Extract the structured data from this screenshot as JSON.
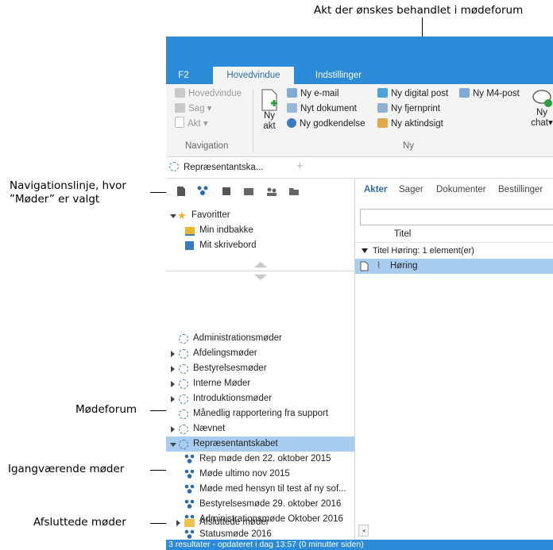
{
  "callouts": {
    "top": "Akt der ønskes behandlet i mødeforum",
    "nav_line1": "Navigationslinje, hvor",
    "nav_line2": "”Møder” er valgt",
    "forum": "Mødeforum",
    "ongoing": "Igangværende møder",
    "finished": "Afsluttede møder"
  },
  "ribbon_tabs": [
    "F2",
    "Hovedvindue",
    "Indstillinger"
  ],
  "navigation_group": {
    "items": [
      "Hovedvindue",
      "Sag",
      "Akt"
    ],
    "label": "Navigation"
  },
  "new_act": {
    "line1": "Ny",
    "line2": "akt"
  },
  "new_group": {
    "col1": [
      "Ny e-mail",
      "Nyt dokument",
      "Ny godkendelse"
    ],
    "col2": [
      "Ny digital post",
      "Ny fjernprint",
      "Ny aktindsigt"
    ],
    "col3": [
      "Ny M4-post"
    ],
    "label": "Ny"
  },
  "chat": {
    "line1": "Ny",
    "line2": "chat"
  },
  "doc_tab": "Repræsentantska...",
  "favorites": {
    "title": "Favoritter",
    "items": [
      "Min indbakke",
      "Mit skrivebord"
    ]
  },
  "forums": [
    "Administrationsmøder",
    "Afdelingsmøder",
    "Bestyrelsesmøder",
    "Interne Møder",
    "Introduktionsmøder",
    "Månedlig rapportering fra support",
    "Nævnet",
    "Repræsentantskabet"
  ],
  "meetings": [
    "Rep møde den 22. oktober 2015",
    "Møde ultimo nov 2015",
    "Møde med hensyn til test af ny sof...",
    "Bestyrelsesmøde 29. oktober 2016",
    "Administrationsmøde Oktober 2016",
    "Statusmøde 2016"
  ],
  "finished_meetings": "Afsluttede møder",
  "result_tabs": [
    "Akter",
    "Sager",
    "Dokumenter",
    "Bestillinger"
  ],
  "column_header": "Titel",
  "group_header": "Titel Høring: 1 element(er)",
  "result_row": "Høring",
  "status": "3 resultater - opdateret i dag 13:57 (0 minutter siden)"
}
